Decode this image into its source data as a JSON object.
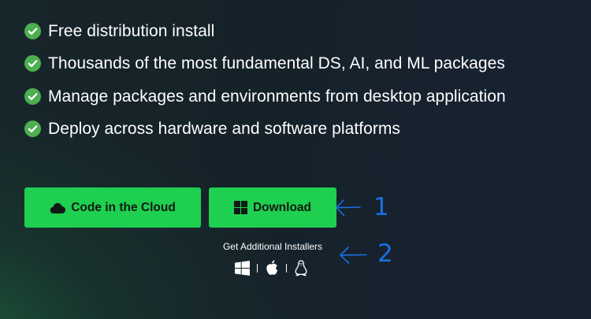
{
  "features": [
    {
      "text": "Free distribution install",
      "icon": "check-circle-icon"
    },
    {
      "text": "Thousands of the most fundamental DS, AI, and ML packages",
      "icon": "check-circle-icon"
    },
    {
      "text": "Manage packages and environments from desktop application",
      "icon": "check-circle-icon"
    },
    {
      "text": "Deploy across hardware and software platforms",
      "icon": "check-circle-icon"
    }
  ],
  "buttons": {
    "cloud": {
      "label": "Code in the Cloud",
      "icon": "cloud-icon"
    },
    "download": {
      "label": "Download",
      "icon": "windows-icon"
    }
  },
  "installers": {
    "label": "Get Additional Installers",
    "platforms": [
      "windows-icon",
      "apple-icon",
      "linux-icon"
    ]
  },
  "annotations": {
    "first": "1",
    "second": "2"
  },
  "colors": {
    "accent_green": "#1fcf4f",
    "check_green": "#4caf50",
    "annotation_blue": "#1a6fe0",
    "background": "#17232d"
  }
}
